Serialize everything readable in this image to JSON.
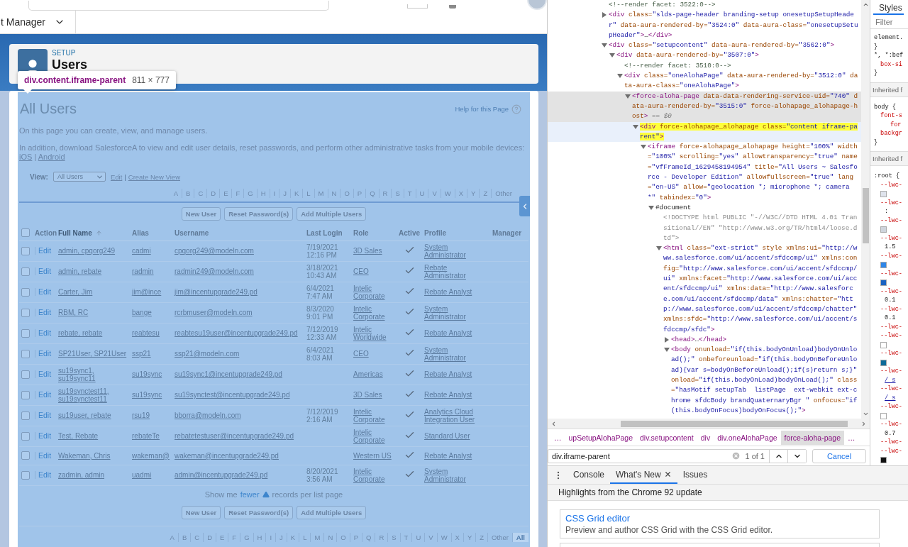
{
  "browser_bar": {
    "nav_label": "t Manager"
  },
  "setup_header": {
    "eyebrow": "SETUP",
    "title": "Users"
  },
  "inspect_tooltip": {
    "selector": "div.content.iframe-parent",
    "size": "811 × 777"
  },
  "page": {
    "title": "All Users",
    "help_link": "Help for this Page",
    "intro": "On this page you can create, view, and manage users.",
    "mobile_note": "In addition, download SalesforceA to view and edit user details, reset passwords, and perform other administrative tasks from your mobile devices:",
    "mobile_links": [
      "iOS",
      "Android"
    ],
    "link_separator": "|",
    "view": {
      "label": "View:",
      "value": "All Users",
      "links": [
        "Edit",
        "Create New View"
      ],
      "separator": "|"
    },
    "alphabet_top": [
      {
        "label": "A",
        "selected": false
      },
      {
        "label": "B",
        "selected": false
      },
      {
        "label": "C",
        "selected": false
      },
      {
        "label": "D",
        "selected": false
      },
      {
        "label": "E",
        "selected": false
      },
      {
        "label": "F",
        "selected": false
      },
      {
        "label": "G",
        "selected": false
      },
      {
        "label": "H",
        "selected": false
      },
      {
        "label": "I",
        "selected": false
      },
      {
        "label": "J",
        "selected": false
      },
      {
        "label": "K",
        "selected": false
      },
      {
        "label": "L",
        "selected": false
      },
      {
        "label": "M",
        "selected": false
      },
      {
        "label": "N",
        "selected": false
      },
      {
        "label": "O",
        "selected": false
      },
      {
        "label": "P",
        "selected": false
      },
      {
        "label": "Q",
        "selected": false
      },
      {
        "label": "R",
        "selected": false
      },
      {
        "label": "S",
        "selected": false
      },
      {
        "label": "T",
        "selected": false
      },
      {
        "label": "U",
        "selected": false
      },
      {
        "label": "V",
        "selected": false
      },
      {
        "label": "W",
        "selected": false
      },
      {
        "label": "X",
        "selected": false
      },
      {
        "label": "Y",
        "selected": false
      },
      {
        "label": "Z",
        "selected": false
      },
      {
        "label": "Other",
        "selected": false
      }
    ],
    "buttons_top": [
      "New User",
      "Reset Password(s)",
      "Add Multiple Users"
    ],
    "table": {
      "select_all": {
        "checked": false
      },
      "columns": [
        {
          "label": "Action",
          "sorted": false
        },
        {
          "label": "Full Name",
          "sorted": true
        },
        {
          "label": "Alias",
          "sorted": false
        },
        {
          "label": "Username",
          "sorted": false
        },
        {
          "label": "Last Login",
          "sorted": false
        },
        {
          "label": "Role",
          "sorted": false
        },
        {
          "label": "Active",
          "sorted": false
        },
        {
          "label": "Profile",
          "sorted": false
        },
        {
          "label": "Manager",
          "sorted": false
        }
      ],
      "rows": [
        {
          "selected": false,
          "action": "Edit",
          "full_name": "admin, cpqorg249",
          "alias": "cadmi",
          "username": "cpqorg249@modeln.com",
          "last_login": "7/19/2021 12:16 PM",
          "role": "3D Sales",
          "active": true,
          "profile": "System Administrator"
        },
        {
          "selected": false,
          "action": "Edit",
          "full_name": "admin, rebate",
          "alias": "radmin",
          "username": "radmin249@modeln.com",
          "last_login": "3/18/2021 10:43 AM",
          "role": "CEO",
          "active": true,
          "profile": "Rebate Administrator"
        },
        {
          "selected": false,
          "action": "Edit",
          "full_name": "Carter, Jim",
          "alias": "jim@ince",
          "username": "jim@incentupgrade249.pd",
          "last_login": "6/4/2021 7:47 AM",
          "role": "Intelic Corporate",
          "active": true,
          "profile": "Rebate Analyst"
        },
        {
          "selected": false,
          "action": "Edit",
          "full_name": "RBM, RC",
          "alias": "bange",
          "username": "rcrbmuser@modeln.com",
          "last_login": "8/3/2020 9:01 PM",
          "role": "Intelic Corporate",
          "active": true,
          "profile": "System Administrator"
        },
        {
          "selected": false,
          "action": "Edit",
          "full_name": "rebate, rebate",
          "alias": "reabtesu",
          "username": "reabtesu19user@incentupgrade249.pd",
          "last_login": "7/12/2019 12:33 AM",
          "role": "Intelic Worldwide",
          "active": true,
          "profile": "Rebate Analyst"
        },
        {
          "selected": false,
          "action": "Edit",
          "full_name": "SP21User, SP21User",
          "alias": "ssp21",
          "username": "ssp21@modeln.com",
          "last_login": "6/4/2021 8:03 AM",
          "role": "CEO",
          "active": true,
          "profile": "System Administrator"
        },
        {
          "selected": false,
          "action": "Edit",
          "full_name": "su19sync1, su19sync11",
          "alias": "su19sync",
          "username": "su19sync1@incentupgrade249.pd",
          "role": "Americas",
          "active": true,
          "profile": "Rebate Analyst"
        },
        {
          "selected": false,
          "action": "Edit",
          "full_name": "su19synctest11, su19synctest11",
          "alias": "su19sync",
          "username": "su19synctest@incentupgrade249.pd",
          "role": "3D Sales",
          "active": true,
          "profile": "Rebate Analyst"
        },
        {
          "selected": false,
          "action": "Edit",
          "full_name": "su19user, rebate",
          "alias": "rsu19",
          "username": "bborra@modeln.com",
          "last_login": "7/12/2019 2:16 AM",
          "role": "Intelic Corporate",
          "active": true,
          "profile": "Analytics Cloud Integration User"
        },
        {
          "selected": false,
          "action": "Edit",
          "full_name": "Test, Rebate",
          "alias": "rebateTe",
          "username": "rebatetestuser@incentupgrade249.pd",
          "role": "Intelic Corporate",
          "active": true,
          "profile": "Standard User"
        },
        {
          "selected": false,
          "action": "Edit",
          "full_name": "Wakeman, Chris",
          "alias": "wakeman@",
          "username": "wakeman@incentupgrade249.pd",
          "role": "Western US",
          "active": true,
          "profile": "Rebate Analyst"
        },
        {
          "selected": false,
          "action": "Edit",
          "full_name": "zadmin, admin",
          "alias": "uadmi",
          "username": "admin@incentupgrade249.pd",
          "last_login": "8/20/2021 3:56 AM",
          "role": "Intelic Corporate",
          "active": true,
          "profile": "System Administrator"
        }
      ]
    },
    "pager": {
      "before": "Show me",
      "link": "fewer",
      "after": "records per list page"
    },
    "buttons_bottom": [
      "New User",
      "Reset Password(s)",
      "Add Multiple Users"
    ],
    "alphabet_bottom": [
      {
        "label": "A",
        "selected": false
      },
      {
        "label": "B",
        "selected": false
      },
      {
        "label": "C",
        "selected": false
      },
      {
        "label": "D",
        "selected": false
      },
      {
        "label": "E",
        "selected": false
      },
      {
        "label": "F",
        "selected": false
      },
      {
        "label": "G",
        "selected": false
      },
      {
        "label": "H",
        "selected": false
      },
      {
        "label": "I",
        "selected": false
      },
      {
        "label": "J",
        "selected": false
      },
      {
        "label": "K",
        "selected": false
      },
      {
        "label": "L",
        "selected": false
      },
      {
        "label": "M",
        "selected": false
      },
      {
        "label": "N",
        "selected": false
      },
      {
        "label": "O",
        "selected": false
      },
      {
        "label": "P",
        "selected": false
      },
      {
        "label": "Q",
        "selected": false
      },
      {
        "label": "R",
        "selected": false
      },
      {
        "label": "S",
        "selected": false
      },
      {
        "label": "T",
        "selected": false
      },
      {
        "label": "U",
        "selected": false
      },
      {
        "label": "V",
        "selected": false
      },
      {
        "label": "W",
        "selected": false
      },
      {
        "label": "X",
        "selected": false
      },
      {
        "label": "Y",
        "selected": false
      },
      {
        "label": "Z",
        "selected": false
      },
      {
        "label": "Other",
        "selected": false
      },
      {
        "label": "All",
        "selected": true
      }
    ]
  },
  "devtools": {
    "elements": {
      "tree": [
        {
          "kind": "comment",
          "selected": false,
          "hovered": false,
          "match": false,
          "parts": [
            {
              "kind": "comment",
              "text": "<!--render facet: 3522:0-->"
            }
          ]
        },
        {
          "kind": "element",
          "expanded": false,
          "selected": false,
          "hovered": false,
          "match": false,
          "parts": [
            {
              "kind": "tag",
              "text": "<div"
            },
            {
              "kind": "attr",
              "text": " class="
            },
            {
              "kind": "value",
              "text": "\"slds-page-header branding-setup onesetupSetupHeader\""
            },
            {
              "kind": "attr",
              "text": " data-aura-rendered-by="
            },
            {
              "kind": "value",
              "text": "\"3524:0\""
            },
            {
              "kind": "attr",
              "text": " data-aura-class="
            },
            {
              "kind": "value",
              "text": "\"onesetupSetupHeader\""
            },
            {
              "kind": "tag",
              "text": ">"
            },
            {
              "kind": "text",
              "text": "…"
            },
            {
              "kind": "tag",
              "text": "</div>"
            }
          ]
        },
        {
          "kind": "element",
          "expanded": true,
          "selected": false,
          "hovered": false,
          "match": false,
          "parts": [
            {
              "kind": "tag",
              "text": "<div"
            },
            {
              "kind": "attr",
              "text": " class="
            },
            {
              "kind": "value",
              "text": "\"setupcontent\""
            },
            {
              "kind": "attr",
              "text": " data-aura-rendered-by="
            },
            {
              "kind": "value",
              "text": "\"3562:0\""
            },
            {
              "kind": "tag",
              "text": ">"
            }
          ],
          "children": [
            {
              "kind": "element",
              "expanded": true,
              "selected": false,
              "hovered": false,
              "match": false,
              "parts": [
                {
                  "kind": "tag",
                  "text": "<div"
                },
                {
                  "kind": "attr",
                  "text": " data-aura-rendered-by="
                },
                {
                  "kind": "value",
                  "text": "\"3507:0\""
                },
                {
                  "kind": "tag",
                  "text": ">"
                }
              ],
              "children": [
                {
                  "kind": "comment",
                  "selected": false,
                  "hovered": false,
                  "match": false,
                  "parts": [
                    {
                      "kind": "comment",
                      "text": "<!--render facet: 3510:0-->"
                    }
                  ]
                },
                {
                  "kind": "element",
                  "expanded": true,
                  "selected": false,
                  "hovered": false,
                  "match": false,
                  "parts": [
                    {
                      "kind": "tag",
                      "text": "<div"
                    },
                    {
                      "kind": "attr",
                      "text": " class="
                    },
                    {
                      "kind": "value",
                      "text": "\"oneAlohaPage\""
                    },
                    {
                      "kind": "attr",
                      "text": " data-aura-rendered-by="
                    },
                    {
                      "kind": "value",
                      "text": "\"3512:0\""
                    },
                    {
                      "kind": "attr",
                      "text": " data-aura-class="
                    },
                    {
                      "kind": "value",
                      "text": "\"oneAlohaPage\""
                    },
                    {
                      "kind": "tag",
                      "text": ">"
                    }
                  ],
                  "children": [
                    {
                      "kind": "element",
                      "expanded": true,
                      "selected": true,
                      "hovered": false,
                      "match": false,
                      "parts": [
                        {
                          "kind": "tag",
                          "text": "<force-aloha-page"
                        },
                        {
                          "kind": "attr",
                          "text": " data-data-rendering-service-uid="
                        },
                        {
                          "kind": "value",
                          "text": "\"740\""
                        },
                        {
                          "kind": "attr",
                          "text": " data-aura-rendered-by="
                        },
                        {
                          "kind": "value",
                          "text": "\"3515:0\""
                        },
                        {
                          "kind": "attr",
                          "text": " force-alohapage_alohapage-host"
                        },
                        {
                          "kind": "tag",
                          "text": ">"
                        },
                        {
                          "kind": "marker",
                          "text": " == $0"
                        }
                      ],
                      "children": [
                        {
                          "kind": "element",
                          "expanded": true,
                          "selected": false,
                          "hovered": true,
                          "match": true,
                          "parts": [
                            {
                              "kind": "tag",
                              "text": "<div"
                            },
                            {
                              "kind": "attr",
                              "text": " force-alohapage_alohapage class="
                            },
                            {
                              "kind": "value",
                              "text": "\"content iframe-parent\""
                            },
                            {
                              "kind": "tag",
                              "text": ">"
                            }
                          ],
                          "children": [
                            {
                              "kind": "element",
                              "expanded": true,
                              "selected": false,
                              "hovered": false,
                              "match": false,
                              "parts": [
                                {
                                  "kind": "tag",
                                  "text": "<iframe"
                                },
                                {
                                  "kind": "attr",
                                  "text": " force-alohapage_alohapage height="
                                },
                                {
                                  "kind": "value",
                                  "text": "\"100%\""
                                },
                                {
                                  "kind": "attr",
                                  "text": " width="
                                },
                                {
                                  "kind": "value",
                                  "text": "\"100%\""
                                },
                                {
                                  "kind": "attr",
                                  "text": " scrolling="
                                },
                                {
                                  "kind": "value",
                                  "text": "\"yes\""
                                },
                                {
                                  "kind": "attr",
                                  "text": " allowtransparency="
                                },
                                {
                                  "kind": "value",
                                  "text": "\"true\""
                                },
                                {
                                  "kind": "attr",
                                  "text": " name="
                                },
                                {
                                  "kind": "value",
                                  "text": "\"vfFrameId_1629458194954\""
                                },
                                {
                                  "kind": "attr",
                                  "text": " title="
                                },
                                {
                                  "kind": "value",
                                  "text": "\"All Users ~ Salesforce - Developer Edition\""
                                },
                                {
                                  "kind": "attr",
                                  "text": " allowfullscreen="
                                },
                                {
                                  "kind": "value",
                                  "text": "\"true\""
                                },
                                {
                                  "kind": "attr",
                                  "text": " lang="
                                },
                                {
                                  "kind": "value",
                                  "text": "\"en-US\""
                                },
                                {
                                  "kind": "attr",
                                  "text": " allow="
                                },
                                {
                                  "kind": "value",
                                  "text": "\"geolocation *; microphone *; camera *\""
                                },
                                {
                                  "kind": "attr",
                                  "text": " tabindex="
                                },
                                {
                                  "kind": "value",
                                  "text": "\"0\""
                                },
                                {
                                  "kind": "tag",
                                  "text": ">"
                                }
                              ],
                              "children": [
                                {
                                  "kind": "document",
                                  "expanded": true,
                                  "selected": false,
                                  "hovered": false,
                                  "match": false,
                                  "parts": [
                                    {
                                      "kind": "text",
                                      "text": "#document"
                                    }
                                  ],
                                  "children": [
                                    {
                                      "kind": "doctype",
                                      "selected": false,
                                      "hovered": false,
                                      "match": false,
                                      "parts": [
                                        {
                                          "kind": "doctype",
                                          "text": "<!DOCTYPE html PUBLIC \"-//W3C//DTD HTML 4.01 Transitional//EN\" \"http://www.w3.org/TR/html4/loose.dtd\">"
                                        }
                                      ]
                                    },
                                    {
                                      "kind": "element",
                                      "expanded": true,
                                      "selected": false,
                                      "hovered": false,
                                      "match": false,
                                      "parts": [
                                        {
                                          "kind": "tag",
                                          "text": "<html"
                                        },
                                        {
                                          "kind": "attr",
                                          "text": " class="
                                        },
                                        {
                                          "kind": "value",
                                          "text": "\"ext-strict\""
                                        },
                                        {
                                          "kind": "attr",
                                          "text": " style xmlns:ui="
                                        },
                                        {
                                          "kind": "value",
                                          "text": "\"http://www.salesforce.com/ui/accent/sfdccmp/ui\""
                                        },
                                        {
                                          "kind": "attr",
                                          "text": " xmlns:config="
                                        },
                                        {
                                          "kind": "value",
                                          "text": "\"http://www.salesforce.com/ui/accent/sfdccmp/ui\""
                                        },
                                        {
                                          "kind": "attr",
                                          "text": " xmlns:facet="
                                        },
                                        {
                                          "kind": "value",
                                          "text": "\"http://www.salesforce.com/ui/accent/sfdccmp/ui\""
                                        },
                                        {
                                          "kind": "attr",
                                          "text": " xmlns:data="
                                        },
                                        {
                                          "kind": "value",
                                          "text": "\"http://www.salesforce.com/ui/accent/sfdccmp/data\""
                                        },
                                        {
                                          "kind": "attr",
                                          "text": " xmlns:chatter="
                                        },
                                        {
                                          "kind": "value",
                                          "text": "\"http://www.salesforce.com/ui/accent/sfdccmp/chatter\""
                                        },
                                        {
                                          "kind": "attr",
                                          "text": " xmlns:sfdc="
                                        },
                                        {
                                          "kind": "value",
                                          "text": "\"http://www.salesforce.com/ui/accent/sfdccmp/sfdc\""
                                        },
                                        {
                                          "kind": "tag",
                                          "text": ">"
                                        }
                                      ],
                                      "children": [
                                        {
                                          "kind": "element",
                                          "expanded": false,
                                          "selected": false,
                                          "hovered": false,
                                          "match": false,
                                          "parts": [
                                            {
                                              "kind": "tag",
                                              "text": "<head>"
                                            },
                                            {
                                              "kind": "text",
                                              "text": "…"
                                            },
                                            {
                                              "kind": "tag",
                                              "text": "</head>"
                                            }
                                          ]
                                        },
                                        {
                                          "kind": "element",
                                          "expanded": true,
                                          "selected": false,
                                          "hovered": false,
                                          "match": false,
                                          "parts": [
                                            {
                                              "kind": "tag",
                                              "text": "<body"
                                            },
                                            {
                                              "kind": "attr",
                                              "text": " onunload="
                                            },
                                            {
                                              "kind": "value",
                                              "text": "\"if(this.bodyOnUnload)bodyOnUnload();\""
                                            },
                                            {
                                              "kind": "attr",
                                              "text": " onbeforeunload="
                                            },
                                            {
                                              "kind": "value",
                                              "text": "\"if(this.bodyOnBeforeUnload){var s=bodyOnBeforeUnload();if(s)return s;}\""
                                            },
                                            {
                                              "kind": "attr",
                                              "text": " onload="
                                            },
                                            {
                                              "kind": "value",
                                              "text": "\"if(this.bodyOnLoad)bodyOnLoad();\""
                                            },
                                            {
                                              "kind": "attr",
                                              "text": " class="
                                            },
                                            {
                                              "kind": "value",
                                              "text": "\"hasMotif setupTab  listPage  ext-webkit ext-chrome sfdcBody brandQuaternaryBgr \""
                                            },
                                            {
                                              "kind": "attr",
                                              "text": " onfocus="
                                            },
                                            {
                                              "kind": "value",
                                              "text": "\"if(this.bodyOnFocus)bodyOnFocus();\""
                                            },
                                            {
                                              "kind": "tag",
                                              "text": ">"
                                            }
                                          ]
                                        }
                                      ]
                                    }
                                  ]
                                }
                              ]
                            }
                          ]
                        }
                      ]
                    }
                  ]
                }
              ]
            }
          ]
        }
      ]
    },
    "breadcrumbs": [
      {
        "label": "…",
        "selected": false
      },
      {
        "label": "upSetupAlohaPage",
        "selected": false
      },
      {
        "label": "div.setupcontent",
        "selected": false
      },
      {
        "label": "div",
        "selected": false
      },
      {
        "label": "div.oneAlohaPage",
        "selected": false
      },
      {
        "label": "force-aloha-page",
        "selected": true
      },
      {
        "label": "…",
        "selected": false
      }
    ],
    "search": {
      "value": "div.iframe-parent",
      "count": "1 of 1",
      "cancel": "Cancel"
    },
    "styles": {
      "tab": "Styles",
      "filter_placeholder": "Filter",
      "lines": [
        {
          "kind": "selector",
          "text": "element."
        },
        {
          "kind": "brace",
          "text": "}"
        },
        {
          "kind": "selector",
          "text": "*, *:bef"
        },
        {
          "kind": "prop",
          "text": "box-si"
        },
        {
          "kind": "brace",
          "text": "}"
        },
        {
          "kind": "section",
          "text": "Inherited f"
        },
        {
          "kind": "selector",
          "text": "body {"
        },
        {
          "kind": "prop",
          "text": "font-s"
        },
        {
          "kind": "subprop",
          "text": "for"
        },
        {
          "kind": "prop",
          "text": "backgr"
        },
        {
          "kind": "brace",
          "text": "}"
        },
        {
          "kind": "section",
          "text": "Inherited f"
        },
        {
          "kind": "selector",
          "text": ":root {"
        },
        {
          "kind": "prop",
          "text": "--lwc-"
        },
        {
          "kind": "swatch",
          "color": "#dfe3ec"
        },
        {
          "kind": "prop",
          "text": "--lwc-"
        },
        {
          "kind": "value",
          "text": ":"
        },
        {
          "kind": "prop",
          "text": "--lwc-"
        },
        {
          "kind": "swatch",
          "color": "#cfd4dc"
        },
        {
          "kind": "prop",
          "text": "--lwc-"
        },
        {
          "kind": "value",
          "text": "1.5"
        },
        {
          "kind": "prop",
          "text": "--lwc-"
        },
        {
          "kind": "swatch",
          "color": "#2e86e8"
        },
        {
          "kind": "prop",
          "text": "--lwc-"
        },
        {
          "kind": "swatch",
          "color": "#1b63c1"
        },
        {
          "kind": "prop",
          "text": "--lwc-"
        },
        {
          "kind": "value",
          "text": "0.1"
        },
        {
          "kind": "prop",
          "text": "--lwc-"
        },
        {
          "kind": "value",
          "text": "0.1"
        },
        {
          "kind": "prop",
          "text": "--lwc-"
        },
        {
          "kind": "prop",
          "text": "--lwc-"
        },
        {
          "kind": "swatch",
          "color": "#ffffff"
        },
        {
          "kind": "prop",
          "text": "--lwc-"
        },
        {
          "kind": "swatch",
          "color": "#0e6b99"
        },
        {
          "kind": "prop",
          "text": "--lwc-"
        },
        {
          "kind": "link",
          "text": "/ s"
        },
        {
          "kind": "prop",
          "text": "--lwc-"
        },
        {
          "kind": "link",
          "text": "/ s"
        },
        {
          "kind": "prop",
          "text": "--lwc-"
        },
        {
          "kind": "swatch",
          "color": "#ffffff"
        },
        {
          "kind": "prop",
          "text": "--lwc-"
        },
        {
          "kind": "value",
          "text": "0.7"
        },
        {
          "kind": "prop",
          "text": "--lwc-"
        },
        {
          "kind": "prop",
          "text": "--lwc-"
        },
        {
          "kind": "swatch",
          "color": "#111111"
        }
      ]
    },
    "drawer": {
      "tabs": [
        {
          "label": "Console",
          "selected": false,
          "closable": false
        },
        {
          "label": "What's New",
          "selected": true,
          "closable": true
        },
        {
          "label": "Issues",
          "selected": false,
          "closable": false
        }
      ],
      "banner": "Highlights from the Chrome 92 update",
      "cards": [
        {
          "title": "CSS Grid editor",
          "description": "Preview and author CSS Grid with the CSS Grid editor."
        }
      ]
    }
  }
}
